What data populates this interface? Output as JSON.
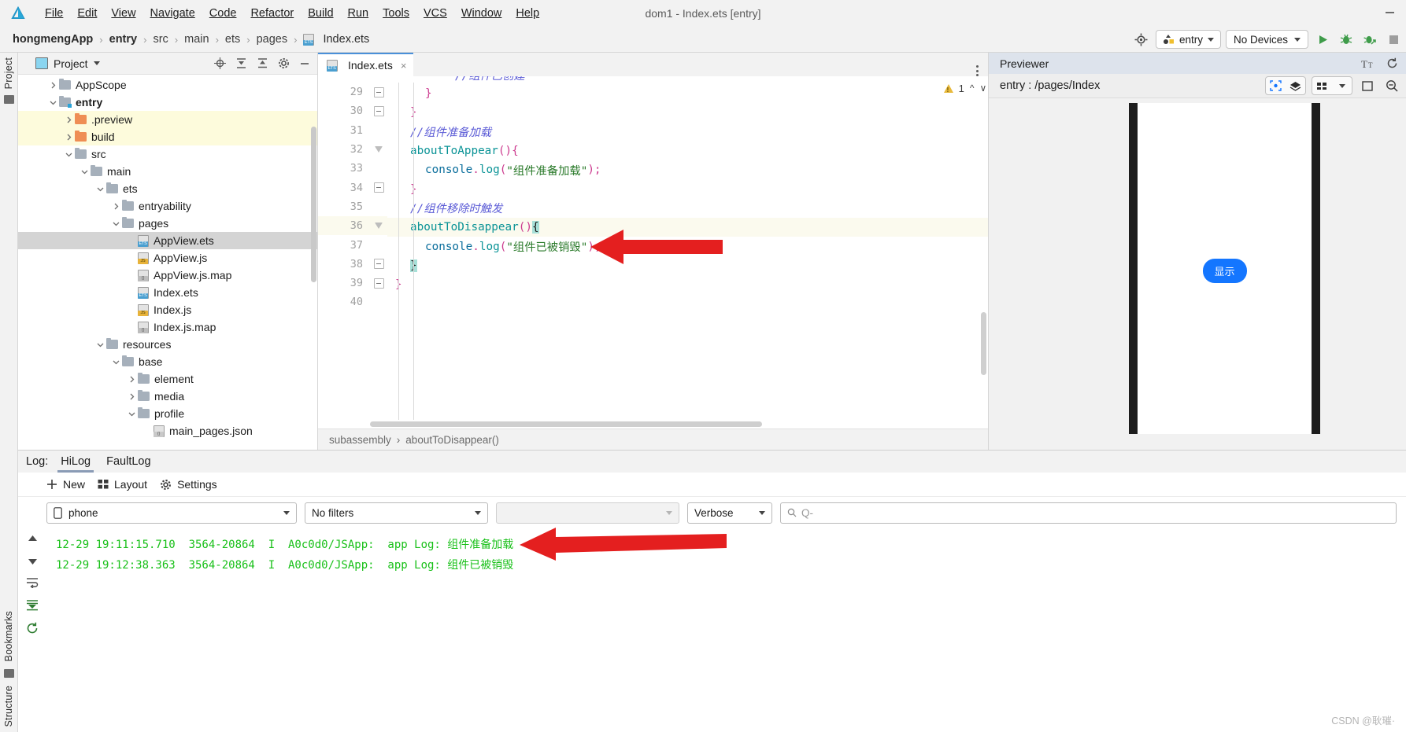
{
  "window": {
    "title": "dom1 - Index.ets [entry]",
    "minimize_label": "—"
  },
  "menu": {
    "items": [
      "File",
      "Edit",
      "View",
      "Navigate",
      "Code",
      "Refactor",
      "Build",
      "Run",
      "Tools",
      "VCS",
      "Window",
      "Help"
    ]
  },
  "breadcrumb": {
    "items": [
      "hongmengApp",
      "entry",
      "src",
      "main",
      "ets",
      "pages",
      "Index.ets"
    ],
    "separator": "›"
  },
  "toolbar": {
    "target_icon": "target-icon",
    "run_config": "entry",
    "device": "No Devices",
    "run_icon": "run-icon",
    "debug_icon": "debug-icon",
    "attach_debug_icon": "attach-debugger-icon",
    "stop_icon": "stop-icon"
  },
  "left_strip": {
    "project_label": "Project",
    "bookmarks_label": "Bookmarks",
    "structure_label": "Structure"
  },
  "project_panel": {
    "title": "Project",
    "icons": [
      "locate-icon",
      "expand-all-icon",
      "collapse-all-icon",
      "settings-icon",
      "hide-icon"
    ],
    "tree": [
      {
        "label": "AppScope",
        "depth": 1,
        "arrow": "right",
        "kind": "folder",
        "state": "normal"
      },
      {
        "label": "entry",
        "depth": 1,
        "arrow": "down",
        "kind": "folder-module",
        "state": "bold"
      },
      {
        "label": ".preview",
        "depth": 2,
        "arrow": "right",
        "kind": "folder-orange",
        "state": "yellow"
      },
      {
        "label": "build",
        "depth": 2,
        "arrow": "right",
        "kind": "folder-orange",
        "state": "yellow"
      },
      {
        "label": "src",
        "depth": 2,
        "arrow": "down",
        "kind": "folder",
        "state": "normal"
      },
      {
        "label": "main",
        "depth": 3,
        "arrow": "down",
        "kind": "folder",
        "state": "normal"
      },
      {
        "label": "ets",
        "depth": 4,
        "arrow": "down",
        "kind": "folder",
        "state": "normal"
      },
      {
        "label": "entryability",
        "depth": 5,
        "arrow": "right",
        "kind": "folder",
        "state": "normal"
      },
      {
        "label": "pages",
        "depth": 5,
        "arrow": "down",
        "kind": "folder",
        "state": "normal"
      },
      {
        "label": "AppView.ets",
        "depth": 6,
        "arrow": "none",
        "kind": "file-ets",
        "state": "selected"
      },
      {
        "label": "AppView.js",
        "depth": 6,
        "arrow": "none",
        "kind": "file-js",
        "state": "normal"
      },
      {
        "label": "AppView.js.map",
        "depth": 6,
        "arrow": "none",
        "kind": "file-map",
        "state": "normal"
      },
      {
        "label": "Index.ets",
        "depth": 6,
        "arrow": "none",
        "kind": "file-ets",
        "state": "normal"
      },
      {
        "label": "Index.js",
        "depth": 6,
        "arrow": "none",
        "kind": "file-js",
        "state": "normal"
      },
      {
        "label": "Index.js.map",
        "depth": 6,
        "arrow": "none",
        "kind": "file-map",
        "state": "normal"
      },
      {
        "label": "resources",
        "depth": 4,
        "arrow": "down",
        "kind": "folder",
        "state": "normal"
      },
      {
        "label": "base",
        "depth": 5,
        "arrow": "down",
        "kind": "folder",
        "state": "normal"
      },
      {
        "label": "element",
        "depth": 6,
        "arrow": "right",
        "kind": "folder",
        "state": "normal"
      },
      {
        "label": "media",
        "depth": 6,
        "arrow": "right",
        "kind": "folder",
        "state": "normal"
      },
      {
        "label": "profile",
        "depth": 6,
        "arrow": "down",
        "kind": "folder",
        "state": "normal"
      },
      {
        "label": "main_pages.json",
        "depth": 7,
        "arrow": "none",
        "kind": "file-json",
        "state": "normal"
      }
    ]
  },
  "editor": {
    "tab": {
      "label": "Index.ets",
      "close": "×"
    },
    "warning_count": "1",
    "first_partial_line": "//组件已创建",
    "lines": [
      {
        "num": "29",
        "fold": "minus",
        "indent": 2,
        "tokens": [
          {
            "t": "}",
            "c": "pun"
          }
        ]
      },
      {
        "num": "30",
        "fold": "minus",
        "indent": 1,
        "tokens": [
          {
            "t": "}",
            "c": "pun"
          }
        ]
      },
      {
        "num": "31",
        "fold": "none",
        "indent": 1,
        "tokens": [
          {
            "t": "//组件准备加载",
            "c": "cm"
          }
        ]
      },
      {
        "num": "32",
        "fold": "tri",
        "indent": 1,
        "tokens": [
          {
            "t": "aboutToAppear",
            "c": "fn"
          },
          {
            "t": "(){",
            "c": "pun"
          }
        ]
      },
      {
        "num": "33",
        "fold": "none",
        "indent": 2,
        "tokens": [
          {
            "t": "console",
            "c": "obj"
          },
          {
            "t": ".",
            "c": "pun"
          },
          {
            "t": "log",
            "c": "fn"
          },
          {
            "t": "(",
            "c": "pun"
          },
          {
            "t": "\"组件准备加载\"",
            "c": "str"
          },
          {
            "t": ");",
            "c": "pun"
          }
        ]
      },
      {
        "num": "34",
        "fold": "minus",
        "indent": 1,
        "tokens": [
          {
            "t": "}",
            "c": "pun"
          }
        ]
      },
      {
        "num": "35",
        "fold": "none",
        "indent": 1,
        "tokens": [
          {
            "t": "//组件移除时触发",
            "c": "cm"
          }
        ]
      },
      {
        "num": "36",
        "fold": "tri",
        "indent": 1,
        "highlight": true,
        "tokens": [
          {
            "t": "aboutToDisappear",
            "c": "fn"
          },
          {
            "t": "()",
            "c": "pun"
          },
          {
            "t": "{",
            "c": "sel"
          }
        ]
      },
      {
        "num": "37",
        "fold": "none",
        "indent": 2,
        "tokens": [
          {
            "t": "console",
            "c": "obj"
          },
          {
            "t": ".",
            "c": "pun"
          },
          {
            "t": "log",
            "c": "fn"
          },
          {
            "t": "(",
            "c": "pun"
          },
          {
            "t": "\"组件已被销毁\"",
            "c": "str"
          },
          {
            "t": ");",
            "c": "pun"
          }
        ]
      },
      {
        "num": "38",
        "fold": "minus",
        "indent": 1,
        "tokens": [
          {
            "t": "}",
            "c": "sel"
          }
        ]
      },
      {
        "num": "39",
        "fold": "minus",
        "indent": 0,
        "tokens": [
          {
            "t": "}",
            "c": "pun"
          }
        ]
      },
      {
        "num": "40",
        "fold": "none",
        "indent": 0,
        "tokens": []
      }
    ],
    "status_path": [
      "subassembly",
      "aboutToDisappear()"
    ],
    "status_separator": "›"
  },
  "previewer": {
    "title": "Previewer",
    "header_icons": [
      "font-size-icon",
      "refresh-icon"
    ],
    "route": "entry : /pages/Index",
    "toolbar_icons": [
      "inspector-icon",
      "layers-icon",
      "multi-device-icon",
      "chevron-down-icon",
      "rotate-icon",
      "zoom-out-icon"
    ],
    "device_button": "显示"
  },
  "log": {
    "tabs_prefix": "Log:",
    "tabs": [
      "HiLog",
      "FaultLog"
    ],
    "active_tab": "HiLog",
    "actions": [
      {
        "label": "New",
        "icon": "plus-icon"
      },
      {
        "label": "Layout",
        "icon": "grid-icon"
      },
      {
        "label": "Settings",
        "icon": "gear-icon"
      }
    ],
    "filters": {
      "device": "phone",
      "device_icon": "phone-icon",
      "filter": "No filters",
      "process": "",
      "level": "Verbose",
      "search_placeholder": "Q-"
    },
    "side_icons": [
      "scroll-up-icon",
      "scroll-down-icon",
      "soft-wrap-icon",
      "scroll-to-end-icon",
      "restart-icon"
    ],
    "entries": [
      "12-29 19:11:15.710  3564-20864  I  A0c0d0/JSApp:  app Log: 组件准备加载",
      "12-29 19:12:38.363  3564-20864  I  A0c0d0/JSApp:  app Log: 组件已被销毁"
    ],
    "watermark": "CSDN @耿璀·"
  },
  "annotations": {
    "arrow_color": "#e41f1f",
    "arrows": [
      "code-arrow",
      "log-arrow"
    ]
  },
  "colors": {
    "accent_blue": "#1476ff",
    "log_green": "#18c018",
    "warning_yellow": "#e8b93b",
    "tab_underline": "#4a90d9"
  }
}
